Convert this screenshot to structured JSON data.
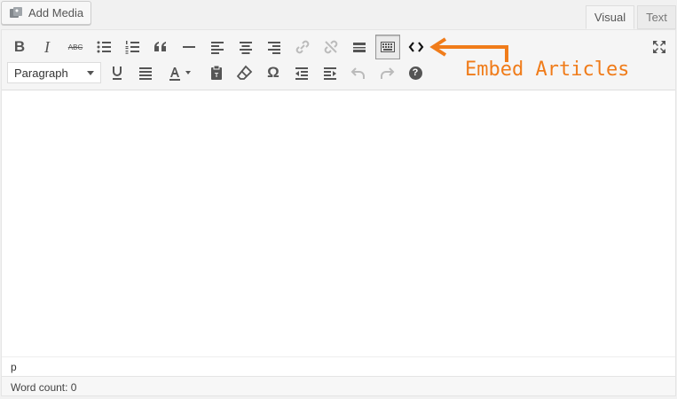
{
  "toolbar_top": {
    "add_media_label": "Add Media",
    "tabs": [
      "Visual",
      "Text"
    ]
  },
  "editor": {
    "format_select": "Paragraph",
    "path": "p",
    "word_count": "Word count: 0"
  },
  "annotation": {
    "text": "Embed Articles",
    "color": "#f07c1a"
  },
  "icons": {
    "bold": "B",
    "italic": "I",
    "strike": "ABC",
    "omega": "Ω",
    "help": "?"
  }
}
